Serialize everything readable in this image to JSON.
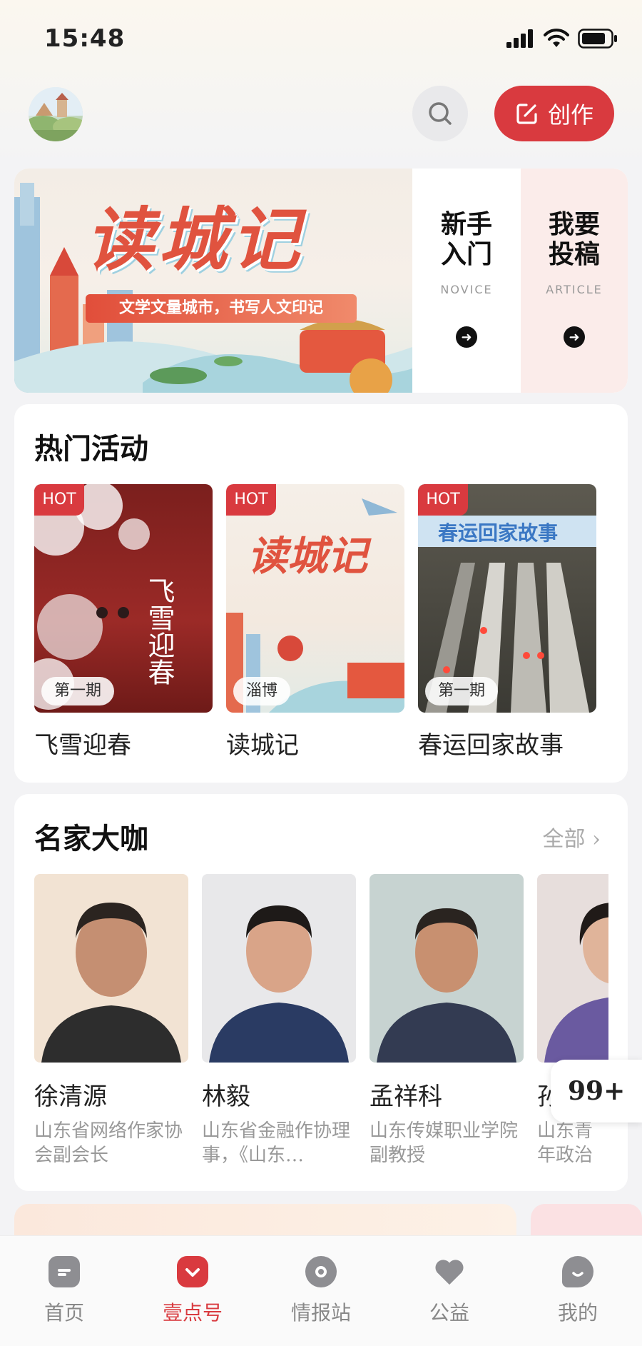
{
  "status": {
    "time": "15:48"
  },
  "header": {
    "create_label": "创作"
  },
  "banner": {
    "title": "读城记",
    "subtitle": "文学文量城市，书写人文印记",
    "novice": {
      "title_line1": "新手",
      "title_line2": "入门",
      "sub": "NOVICE"
    },
    "article": {
      "title_line1": "我要",
      "title_line2": "投稿",
      "sub": "ARTICLE"
    }
  },
  "activities": {
    "title": "热门活动",
    "items": [
      {
        "hot": "HOT",
        "issue": "第一期",
        "name": "飞雪迎春",
        "poster_text": "飞雪迎春"
      },
      {
        "hot": "HOT",
        "issue": "淄博",
        "name": "读城记",
        "poster_text": "读城记"
      },
      {
        "hot": "HOT",
        "issue": "第一期",
        "name": "春运回家故事",
        "poster_text": "春运回家故事"
      }
    ]
  },
  "masters": {
    "title": "名家大咖",
    "all_label": "全部",
    "items": [
      {
        "name": "徐清源",
        "desc": "山东省网络作家协会副会长"
      },
      {
        "name": "林毅",
        "desc": "山东省金融作协理事，《山东…"
      },
      {
        "name": "孟祥科",
        "desc": "山东传媒职业学院副教授"
      },
      {
        "name": "孙",
        "desc": "山东青年政治学院文化传"
      }
    ]
  },
  "badge": "99+",
  "tabs": [
    {
      "label": "首页",
      "icon": "home-icon",
      "active": false
    },
    {
      "label": "壹点号",
      "icon": "yidian-icon",
      "active": true
    },
    {
      "label": "情报站",
      "icon": "info-station-icon",
      "active": false
    },
    {
      "label": "公益",
      "icon": "heart-icon",
      "active": false
    },
    {
      "label": "我的",
      "icon": "profile-icon",
      "active": false
    }
  ],
  "colors": {
    "accent": "#d93a3f",
    "background": "#f3f3f5"
  }
}
